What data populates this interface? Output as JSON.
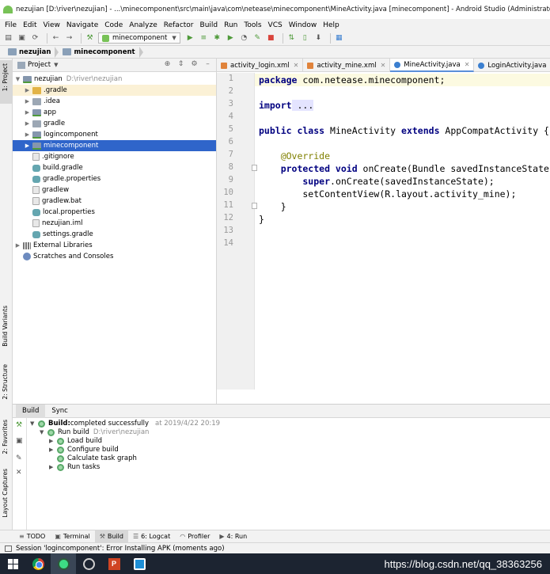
{
  "window": {
    "title": "nezujian [D:\\river\\nezujian] - ...\\minecomponent\\src\\main\\java\\com\\netease\\minecomponent\\MineActivity.java [minecomponent] - Android Studio (Administrator)"
  },
  "menu": [
    "File",
    "Edit",
    "View",
    "Navigate",
    "Code",
    "Analyze",
    "Refactor",
    "Build",
    "Run",
    "Tools",
    "VCS",
    "Window",
    "Help"
  ],
  "toolbar": {
    "run_config": "minecomponent",
    "icons": [
      "save-all-icon",
      "sync-icon",
      "back-icon",
      "forward-icon",
      "build-hammer-icon",
      "run-icon",
      "debug-icon",
      "profile-icon",
      "stop-icon",
      "sdk-manager-icon",
      "avd-manager-icon"
    ]
  },
  "breadcrumb": [
    "nezujian",
    "minecomponent"
  ],
  "left_tool_windows": [
    "1: Project",
    "Build Variants",
    "2: Structure",
    "2: Favorites",
    "Layout Captures"
  ],
  "project": {
    "view_selector": "Project",
    "root": {
      "name": "nezujian",
      "path": "D:\\river\\nezujian"
    },
    "items": [
      {
        "name": ".gradle",
        "icon": "folder-orange"
      },
      {
        "name": ".idea",
        "icon": "folder"
      },
      {
        "name": "app",
        "icon": "folder-module"
      },
      {
        "name": "gradle",
        "icon": "folder"
      },
      {
        "name": "logincomponent",
        "icon": "folder-module"
      },
      {
        "name": "minecomponent",
        "icon": "folder-module"
      },
      {
        "name": ".gitignore",
        "icon": "file"
      },
      {
        "name": "build.gradle",
        "icon": "gradle"
      },
      {
        "name": "gradle.properties",
        "icon": "gradle"
      },
      {
        "name": "gradlew",
        "icon": "file"
      },
      {
        "name": "gradlew.bat",
        "icon": "file"
      },
      {
        "name": "local.properties",
        "icon": "gradle"
      },
      {
        "name": "nezujian.iml",
        "icon": "file"
      },
      {
        "name": "settings.gradle",
        "icon": "gradle"
      }
    ],
    "extra": [
      "External Libraries",
      "Scratches and Consoles"
    ]
  },
  "editor": {
    "tabs": [
      {
        "label": "activity_login.xml",
        "type": "xml"
      },
      {
        "label": "activity_mine.xml",
        "type": "xml"
      },
      {
        "label": "MineActivity.java",
        "type": "java",
        "active": true
      },
      {
        "label": "LoginActivity.java",
        "type": "java"
      }
    ],
    "line_numbers": [
      "1",
      "2",
      "3",
      "4",
      "5",
      "6",
      "7",
      "8",
      "9",
      "10",
      "11",
      "12",
      "13",
      "14"
    ],
    "lines": {
      "l1_kw": "package",
      "l1_rest": " com.netease.minecomponent;",
      "l3_kw": "import",
      "l3_rest": " ...",
      "l6_kw1": "public class",
      "l6_name": " MineActivity ",
      "l6_kw2": "extends",
      "l6_rest": " AppCompatActivity {",
      "l8_annot": "    @Override",
      "l9_kw": "    protected void",
      "l9_rest": " onCreate(Bundle savedInstanceState) {",
      "l10_kw": "        super",
      "l10_rest": ".onCreate(savedInstanceState);",
      "l11": "        setContentView(R.layout.activity_mine);",
      "l12": "    }",
      "l13": "}"
    }
  },
  "build_panel": {
    "tabs": [
      "Build",
      "Sync"
    ],
    "status_bold": "Build:",
    "status_rest": " completed successfully",
    "timestamp": "at 2019/4/22 20:19",
    "run_build": "Run build",
    "run_build_path": "D:\\river\\nezujian",
    "tasks": [
      "Load build",
      "Configure build",
      "Calculate task graph",
      "Run tasks"
    ]
  },
  "bottom_tool_windows": [
    {
      "label": "TODO",
      "icon": "≡"
    },
    {
      "label": "Terminal",
      "icon": "▣"
    },
    {
      "label": "Build",
      "icon": "⚒",
      "active": true
    },
    {
      "label": "6: Logcat",
      "icon": "☰"
    },
    {
      "label": "Profiler",
      "icon": "◠"
    },
    {
      "label": "4: Run",
      "icon": "▶"
    }
  ],
  "status": "Session 'logincomponent': Error Installing APK (moments ago)",
  "watermark": "https://blog.csdn.net/qq_38363256"
}
